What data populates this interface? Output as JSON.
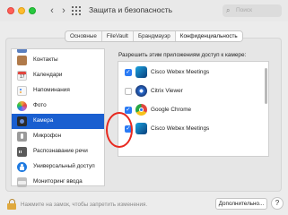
{
  "window": {
    "title": "Защита и безопасность",
    "back_glyph": "‹",
    "forward_glyph": "›",
    "search_placeholder": "Поиск"
  },
  "tabs": [
    {
      "label": "Основные",
      "active": false
    },
    {
      "label": "FileVault",
      "active": false
    },
    {
      "label": "Брандмауэр",
      "active": false
    },
    {
      "label": "Конфиденциальность",
      "active": true
    }
  ],
  "sidebar": {
    "items": [
      {
        "label": "Контакты",
        "icon": "contacts-icon",
        "color": "#b07a4a",
        "selected": false
      },
      {
        "label": "Календари",
        "icon": "calendar-icon",
        "color": "#f2f2f2",
        "selected": false
      },
      {
        "label": "Напоминания",
        "icon": "reminders-icon",
        "color": "#f7f7f7",
        "selected": false
      },
      {
        "label": "Фото",
        "icon": "photos-icon",
        "color": "#f4a73b",
        "selected": false
      },
      {
        "label": "Камера",
        "icon": "camera-icon",
        "color": "#2b2b2b",
        "selected": true
      },
      {
        "label": "Микрофон",
        "icon": "microphone-icon",
        "color": "#9a9a9a",
        "selected": false
      },
      {
        "label": "Распознавание речи",
        "icon": "speech-recognition-icon",
        "color": "#5a5a5a",
        "selected": false
      },
      {
        "label": "Универсальный доступ",
        "icon": "accessibility-icon",
        "color": "#1f7ae0",
        "selected": false
      },
      {
        "label": "Мониторинг ввода",
        "icon": "input-monitoring-icon",
        "color": "#bfbfbf",
        "selected": false
      }
    ]
  },
  "camera_panel": {
    "prompt": "Разрешить этим приложениям доступ к камере:",
    "apps": [
      {
        "name": "Cisco Webex Meetings",
        "checked": true,
        "icon": "webex-icon"
      },
      {
        "name": "Citrix Viewer",
        "checked": false,
        "icon": "citrix-icon"
      },
      {
        "name": "Google Chrome",
        "checked": true,
        "icon": "chrome-icon"
      },
      {
        "name": "Cisco Webex Meetings",
        "checked": true,
        "icon": "webex-icon"
      }
    ]
  },
  "footer": {
    "lock_text": "Нажмите на замок, чтобы запретить изменения.",
    "advanced_label": "Дополнительно...",
    "help_label": "?"
  },
  "colors": {
    "accent": "#1a5fd0",
    "checkbox": "#2a7bf5",
    "annotation": "#e8291f"
  }
}
